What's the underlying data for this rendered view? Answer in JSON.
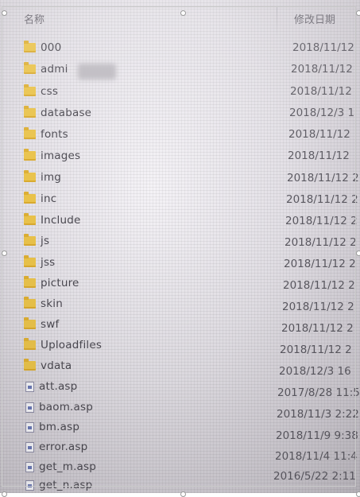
{
  "columns": {
    "name": "名称",
    "date": "修改日期"
  },
  "rows": [
    {
      "name": "000",
      "date": "2018/11/12",
      "type": "folder"
    },
    {
      "name": "admi",
      "date": "2018/11/12",
      "type": "folder"
    },
    {
      "name": "css",
      "date": "2018/11/12",
      "type": "folder"
    },
    {
      "name": "database",
      "date": "2018/12/3 1",
      "type": "folder"
    },
    {
      "name": "fonts",
      "date": "2018/11/12",
      "type": "folder"
    },
    {
      "name": "images",
      "date": "2018/11/12",
      "type": "folder"
    },
    {
      "name": "img",
      "date": "2018/11/12 2",
      "type": "folder"
    },
    {
      "name": "inc",
      "date": "2018/11/12 2",
      "type": "folder"
    },
    {
      "name": "Include",
      "date": "2018/11/12 2",
      "type": "folder"
    },
    {
      "name": "js",
      "date": "2018/11/12 2",
      "type": "folder"
    },
    {
      "name": "jss",
      "date": "2018/11/12 2",
      "type": "folder"
    },
    {
      "name": "picture",
      "date": "2018/11/12 2",
      "type": "folder"
    },
    {
      "name": "skin",
      "date": "2018/11/12 2",
      "type": "folder"
    },
    {
      "name": "swf",
      "date": "2018/11/12 2",
      "type": "folder"
    },
    {
      "name": "Uploadfiles",
      "date": "2018/11/12 2",
      "type": "folder"
    },
    {
      "name": "vdata",
      "date": "2018/12/3 16",
      "type": "folder"
    },
    {
      "name": "att.asp",
      "date": "2017/8/28 11:5",
      "type": "file"
    },
    {
      "name": "baom.asp",
      "date": "2018/11/3 2:22",
      "type": "file"
    },
    {
      "name": "bm.asp",
      "date": "2018/11/9 9:38",
      "type": "file"
    },
    {
      "name": "error.asp",
      "date": "2018/11/4 11:4",
      "type": "file"
    },
    {
      "name": "get_m.asp",
      "date": "2016/5/22 2:11",
      "type": "file"
    },
    {
      "name": "get_n.asp",
      "date": "",
      "type": "file"
    }
  ]
}
